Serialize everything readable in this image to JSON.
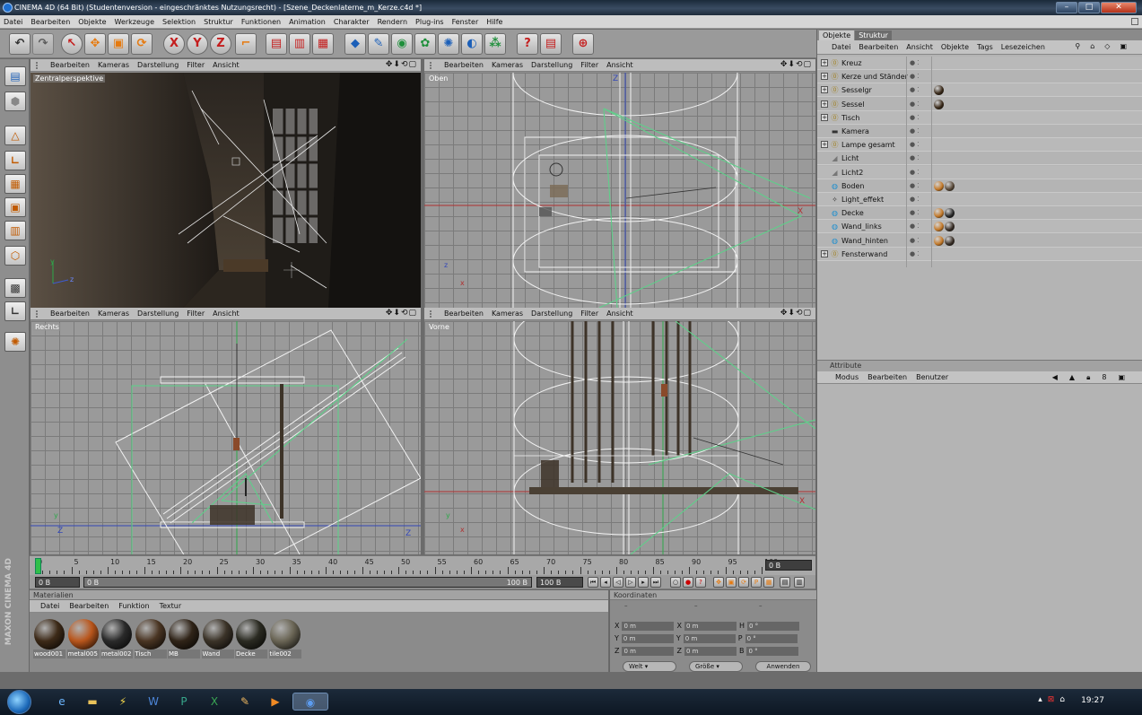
{
  "window": {
    "title": "CINEMA 4D (64 Bit) (Studentenversion - eingeschränktes Nutzungsrecht) - [Szene_Deckenlaterne_m_Kerze.c4d *]",
    "controls": [
      "–",
      "□",
      "✕"
    ]
  },
  "menubar": [
    "Datei",
    "Bearbeiten",
    "Objekte",
    "Werkzeuge",
    "Selektion",
    "Struktur",
    "Funktionen",
    "Animation",
    "Charakter",
    "Rendern",
    "Plug-ins",
    "Fenster",
    "Hilfe"
  ],
  "toolbar": {
    "icons": [
      "undo-icon",
      "redo-icon",
      "live-select-icon",
      "move-icon",
      "scale-icon",
      "rotate-icon",
      "x-axis-icon",
      "y-axis-icon",
      "z-axis-icon",
      "coordinate-system-icon",
      "render-view-icon",
      "render-picture-viewer-icon",
      "render-settings-icon",
      "cube-icon",
      "spline-pen-icon",
      "nurbs-icon",
      "array-icon",
      "deformer-icon",
      "environment-icon",
      "scene-icon",
      "camera-icon",
      "light-icon",
      "globe-icon"
    ],
    "axis_labels": {
      "x": "X",
      "y": "Y",
      "z": "Z"
    }
  },
  "viewport_menu": [
    "Bearbeiten",
    "Kameras",
    "Darstellung",
    "Filter",
    "Ansicht"
  ],
  "viewports": [
    {
      "id": "perspective",
      "label": "Zentralperspektive"
    },
    {
      "id": "top",
      "label": "Oben"
    },
    {
      "id": "right",
      "label": "Rechts"
    },
    {
      "id": "front",
      "label": "Vorne"
    }
  ],
  "axis_letters": {
    "x": "x",
    "y": "y",
    "z": "z",
    "z_cap": "Z",
    "x_cap": "X"
  },
  "timeline": {
    "ticks": [
      "0",
      "5",
      "10",
      "15",
      "20",
      "25",
      "30",
      "35",
      "40",
      "45",
      "50",
      "55",
      "60",
      "65",
      "70",
      "75",
      "80",
      "85",
      "90",
      "95",
      "100"
    ],
    "current_frame": "0 B",
    "start_field": "0 B",
    "range_start": "0 B",
    "range_end": "100 B",
    "end_field": "100 B"
  },
  "materials": {
    "header": "Materialien",
    "menu": [
      "Datei",
      "Bearbeiten",
      "Funktion",
      "Textur"
    ],
    "items": [
      {
        "name": "wood001",
        "color": "#3d2a18"
      },
      {
        "name": "metal005",
        "color": "#b9561c"
      },
      {
        "name": "metal002",
        "color": "#2a2a2a"
      },
      {
        "name": "Tisch",
        "color": "#4a3523"
      },
      {
        "name": "MB",
        "color": "#302418"
      },
      {
        "name": "Wand",
        "color": "#3b3328"
      },
      {
        "name": "Decke",
        "color": "#2b2b22"
      },
      {
        "name": "tile002",
        "color": "#6a6555"
      }
    ]
  },
  "coordinates": {
    "header": "Koordinaten",
    "dashes": [
      "–",
      "–",
      "–"
    ],
    "rows": [
      {
        "a": "X",
        "av": "0 m",
        "b": "X",
        "bv": "0 m",
        "c": "H",
        "cv": "0 °"
      },
      {
        "a": "Y",
        "av": "0 m",
        "b": "Y",
        "bv": "0 m",
        "c": "P",
        "cv": "0 °"
      },
      {
        "a": "Z",
        "av": "0 m",
        "b": "Z",
        "bv": "0 m",
        "c": "B",
        "cv": "0 °"
      }
    ],
    "mode_select": "Welt",
    "size_select": "Größe",
    "apply_button": "Anwenden"
  },
  "object_manager": {
    "tabs": [
      "Objekte",
      "Struktur"
    ],
    "menu": [
      "Datei",
      "Bearbeiten",
      "Ansicht",
      "Objekte",
      "Tags",
      "Lesezeichen"
    ],
    "objects": [
      {
        "name": "Kreuz",
        "icon": "null-icon",
        "tags": []
      },
      {
        "name": "Kerze und Ständer",
        "icon": "null-icon",
        "tags": []
      },
      {
        "name": "Sesselgr",
        "icon": "null-icon",
        "tags": [
          "#3a2a1a"
        ]
      },
      {
        "name": "Sessel",
        "icon": "null-icon",
        "tags": [
          "#3a2a1a"
        ]
      },
      {
        "name": "Tisch",
        "icon": "null-icon",
        "tags": []
      },
      {
        "name": "Kamera",
        "icon": "camera-icon",
        "tags": []
      },
      {
        "name": "Lampe gesamt",
        "icon": "null-icon",
        "tags": []
      },
      {
        "name": "Licht",
        "icon": "light-icon",
        "tags": []
      },
      {
        "name": "Licht2",
        "icon": "light-icon",
        "tags": []
      },
      {
        "name": "Boden",
        "icon": "primitive-icon",
        "tags": [
          "#c47a2a",
          "#5a4a3a"
        ]
      },
      {
        "name": "Light_effekt",
        "icon": "effect-icon",
        "tags": []
      },
      {
        "name": "Decke",
        "icon": "primitive-icon",
        "tags": [
          "#c47a2a",
          "#2a2a2a"
        ]
      },
      {
        "name": "Wand_links",
        "icon": "primitive-icon",
        "tags": [
          "#c47a2a",
          "#3a3028"
        ]
      },
      {
        "name": "Wand_hinten",
        "icon": "primitive-icon",
        "tags": [
          "#c47a2a",
          "#3a3028"
        ]
      },
      {
        "name": "Fensterwand",
        "icon": "null-icon",
        "tags": []
      }
    ]
  },
  "attributes": {
    "header": "Attribute",
    "menu": [
      "Modus",
      "Bearbeiten",
      "Benutzer"
    ]
  },
  "taskbar": {
    "apps": [
      "ie-icon",
      "explorer-icon",
      "winamp-icon",
      "word-icon",
      "publisher-icon",
      "excel-icon",
      "paint-icon",
      "media-icon",
      "cinema4d-icon"
    ],
    "clock": "19:27"
  },
  "brand": "MAXON CINEMA 4D"
}
